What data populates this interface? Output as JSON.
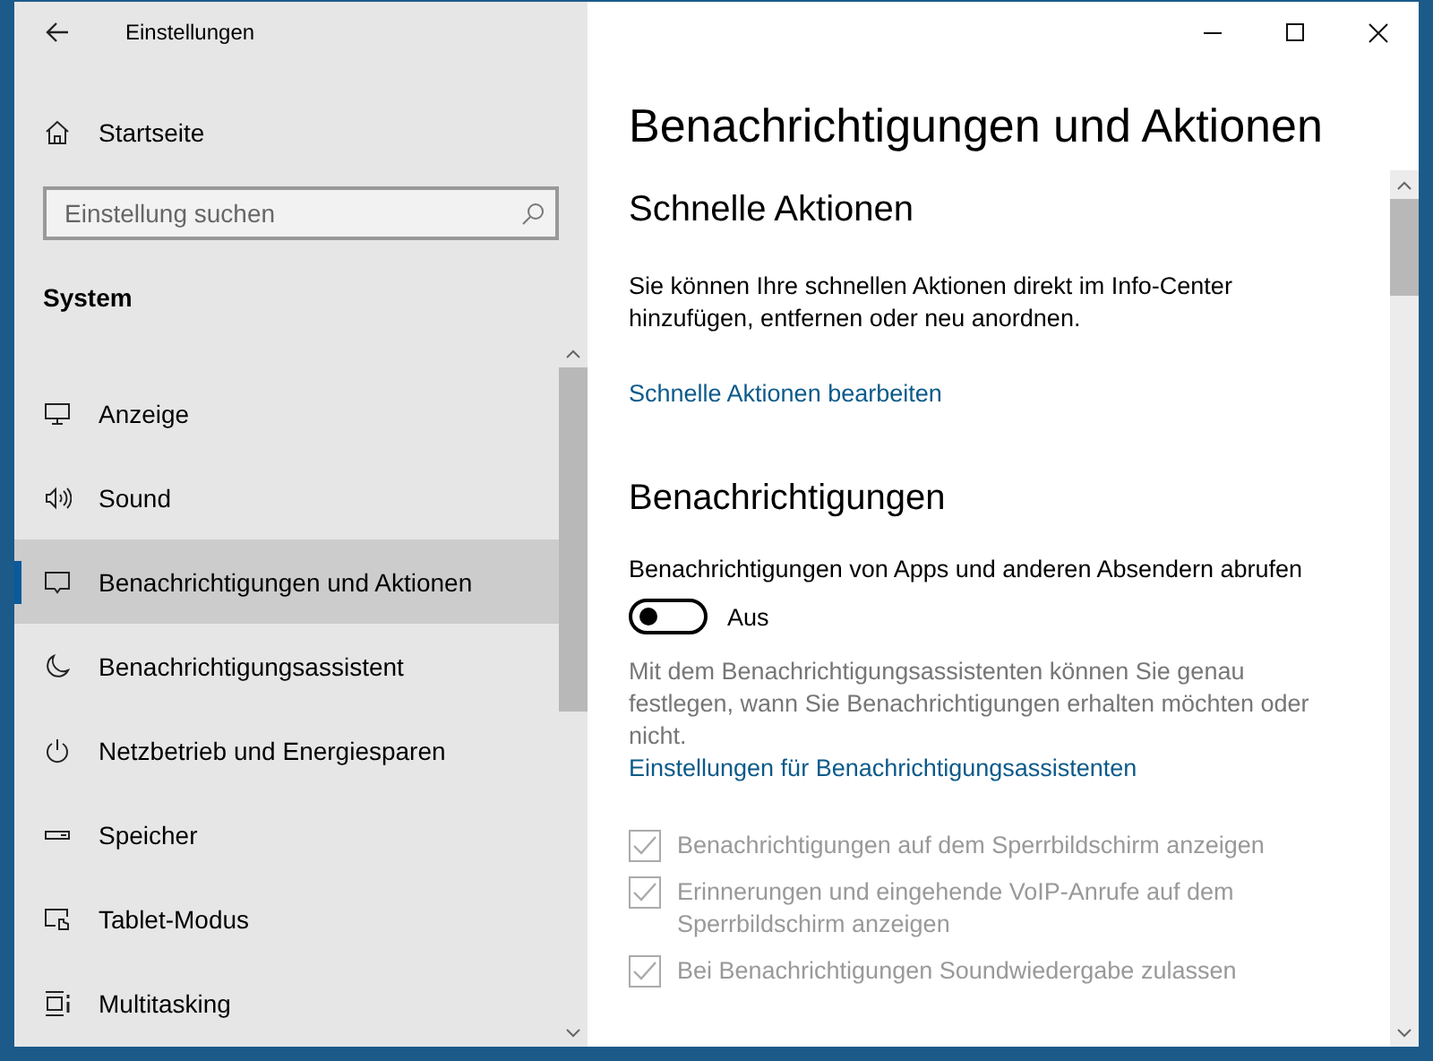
{
  "window": {
    "title": "Einstellungen"
  },
  "sidebar": {
    "home": "Startseite",
    "search": {
      "placeholder": "Einstellung suchen"
    },
    "section": "System",
    "items": [
      {
        "kind": "display",
        "label": "Anzeige",
        "selected": false
      },
      {
        "kind": "sound",
        "label": "Sound",
        "selected": false
      },
      {
        "kind": "notification",
        "label": "Benachrichtigungen und Aktionen",
        "selected": true
      },
      {
        "kind": "moon",
        "label": "Benachrichtigungsassistent",
        "selected": false
      },
      {
        "kind": "power",
        "label": "Netzbetrieb und Energiesparen",
        "selected": false
      },
      {
        "kind": "storage",
        "label": "Speicher",
        "selected": false
      },
      {
        "kind": "tablet",
        "label": "Tablet-Modus",
        "selected": false
      },
      {
        "kind": "multitasking",
        "label": "Multitasking",
        "selected": false
      }
    ]
  },
  "main": {
    "title": "Benachrichtigungen und Aktionen",
    "quick_actions": {
      "heading": "Schnelle Aktionen",
      "description": "Sie können Ihre schnellen Aktionen direkt im Info-Center hinzufügen, entfernen oder neu anordnen.",
      "link": "Schnelle Aktionen bearbeiten"
    },
    "notifications": {
      "heading": "Benachrichtigungen",
      "toggle": {
        "label": "Benachrichtigungen von Apps und anderen Absendern abrufen",
        "on": false,
        "state_text": "Aus"
      },
      "description": "Mit dem Benachrichtigungsassistenten können Sie genau festlegen, wann Sie Benachrichtigungen erhalten möchten oder nicht.",
      "link": "Einstellungen für Benachrichtigungsassistenten",
      "checkboxes": [
        {
          "label": "Benachrichtigungen auf dem Sperrbildschirm anzeigen",
          "checked": true,
          "disabled": true
        },
        {
          "label": "Erinnerungen und eingehende VoIP-Anrufe auf dem Sperrbildschirm anzeigen",
          "checked": true,
          "disabled": true
        },
        {
          "label": "Bei Benachrichtigungen Soundwiedergabe zulassen",
          "checked": true,
          "disabled": true
        }
      ]
    }
  }
}
